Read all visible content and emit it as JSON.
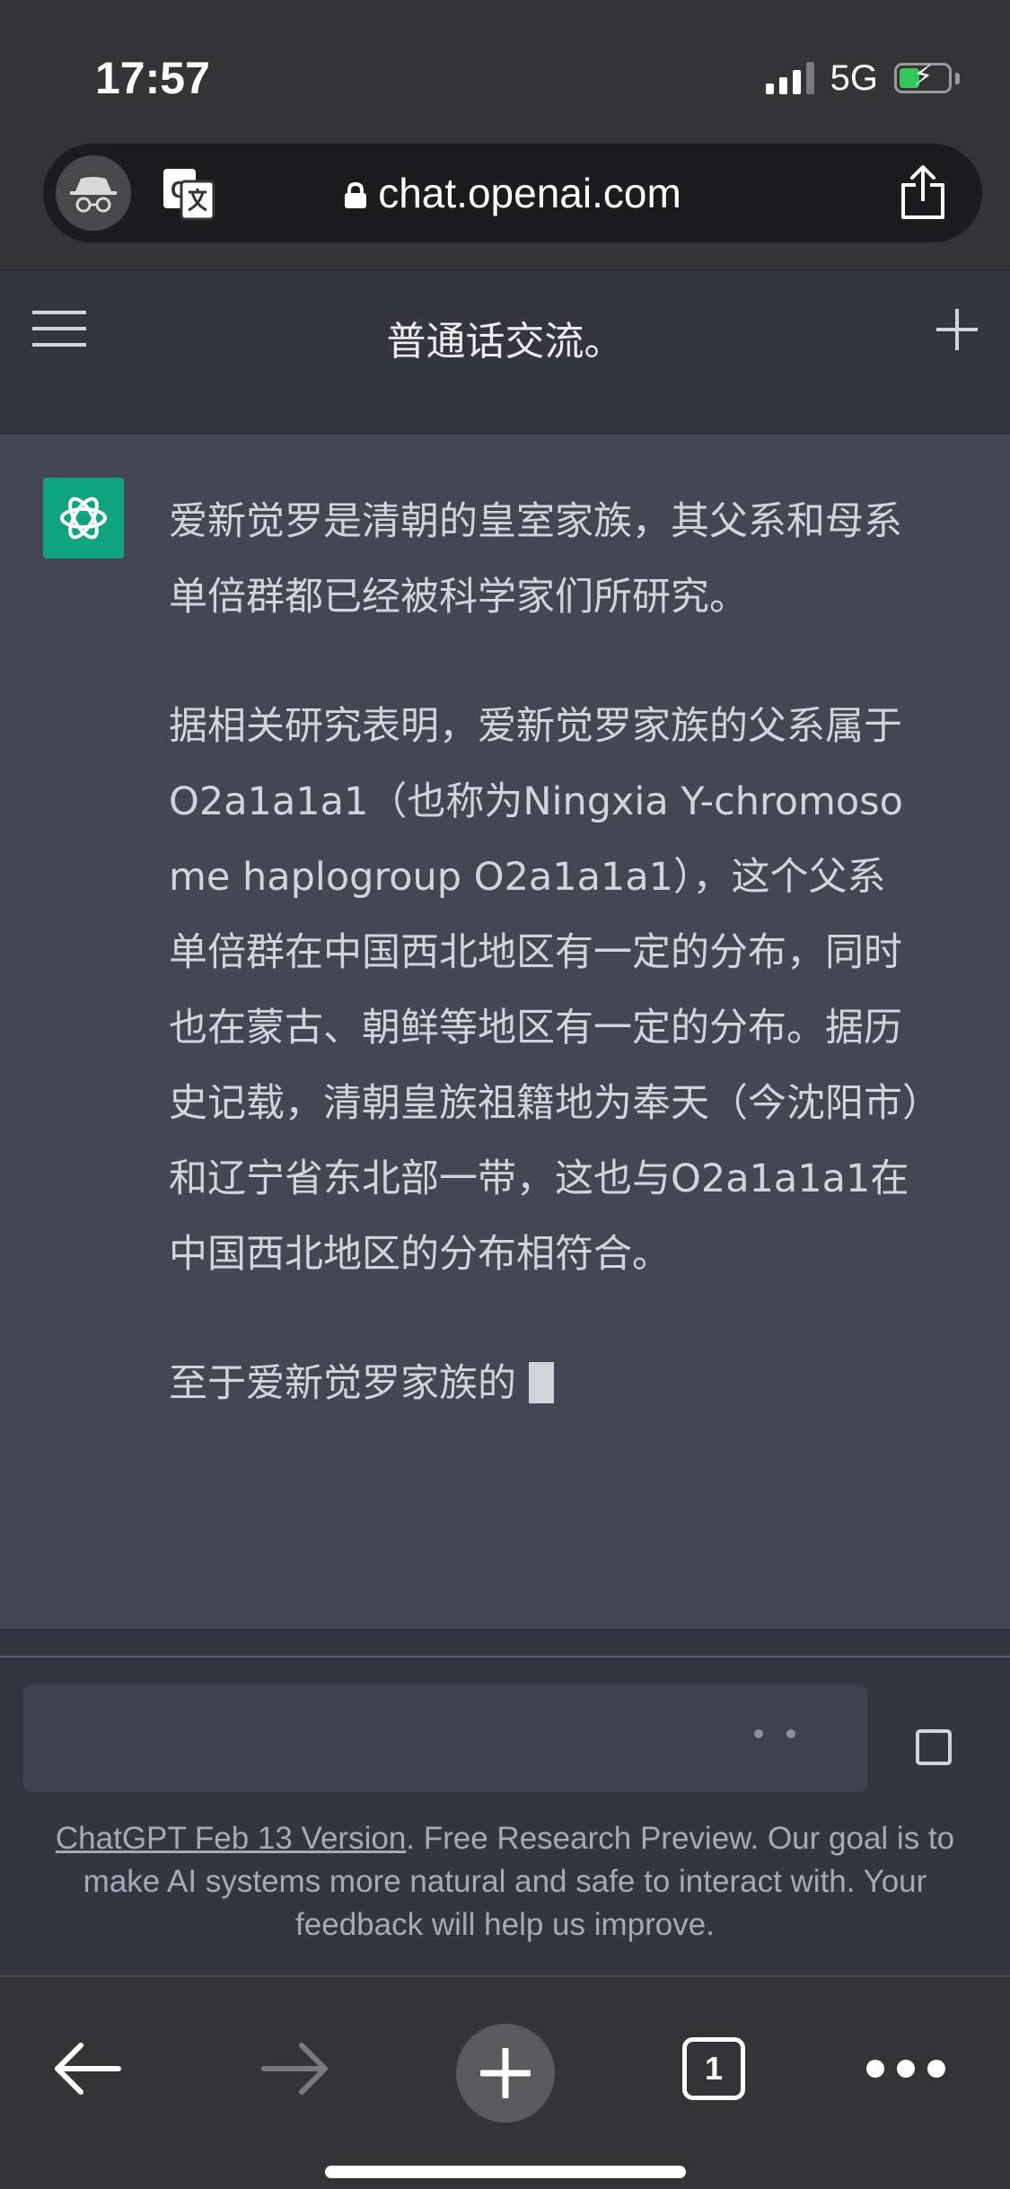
{
  "status_bar": {
    "time": "17:57",
    "network": "5G"
  },
  "browser": {
    "url": "chat.openai.com",
    "tab_count": "1"
  },
  "chat": {
    "title": "普通话交流。",
    "assistant_message": {
      "paragraphs": [
        "爱新觉罗是清朝的皇室家族，其父系和母系单倍群都已经被科学家们所研究。",
        "据相关研究表明，爱新觉罗家族的父系属于O2a1a1a1（也称为Ningxia Y-chromosome haplogroup O2a1a1a1），这个父系单倍群在中国西北地区有一定的分布，同时也在蒙古、朝鲜等地区有一定的分布。据历史记载，清朝皇族祖籍地为奉天（今沈阳市）和辽宁省东北部一带，这也与O2a1a1a1在中国西北地区的分布相符合。",
        "至于爱新觉罗家族的"
      ]
    }
  },
  "composer": {
    "input_value": ""
  },
  "footer": {
    "version_link": "ChatGPT Feb 13 Version",
    "note": ". Free Research Preview. Our goal is to make AI systems more natural and safe to interact with. Your feedback will help us improve."
  },
  "colors": {
    "accent": "#10a37f",
    "background": "#343541",
    "assistant_bg": "#444654",
    "input_bg": "#40414f"
  }
}
